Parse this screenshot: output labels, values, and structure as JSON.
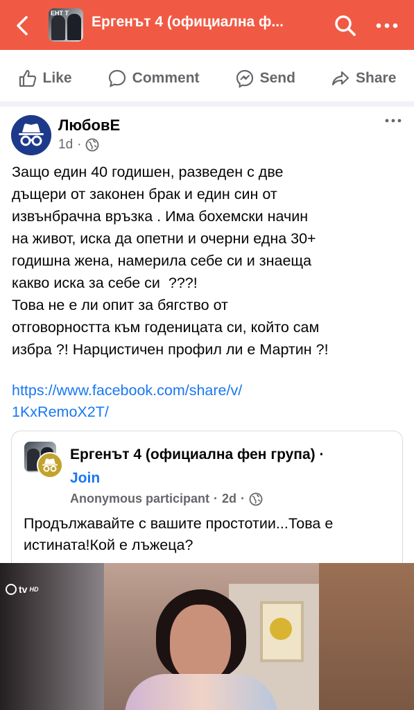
{
  "header": {
    "title": "Ергенът 4 (официална ф...",
    "thumb_text": "ЕНТ Т",
    "bg_color": "#f05a44"
  },
  "actions": [
    {
      "label": "Like",
      "icon": "thumbs-up-icon"
    },
    {
      "label": "Comment",
      "icon": "comment-icon"
    },
    {
      "label": "Send",
      "icon": "messenger-icon"
    },
    {
      "label": "Share",
      "icon": "share-icon"
    }
  ],
  "post": {
    "author": "ЛюбовЕ",
    "time": "1d",
    "separator": "·",
    "body": "Защо един 40 годишен, разведен с две\nдъщери от законен брак и един син от\nизвънбрачна връзка . Има бохемски начин\nна живот, иска да опетни и очерни една 30+\nгодишна жена, намерила себе си и знаеща\nкакво иска за себе си  ???!\nТова не е ли опит за бягство от\nотговорността към годеницата си, който сам\nизбра ?! Нарцистичен профил ли е Мартин ?!",
    "link": "https://www.facebook.com/share/v/\n1KxRemoX2T/"
  },
  "shared": {
    "group_name": "Ергенът 4 (официална фен група) ·",
    "join_label": "Join",
    "participant": "Anonymous participant",
    "time": "2d",
    "separator": "·",
    "body": "Продължавайте с вашите простотии...Това е истината!Кой е лъжеца?"
  },
  "video": {
    "channel_logo": "tv",
    "channel_hd": "HD"
  },
  "colors": {
    "accent": "#1877f2",
    "muted": "#65676b"
  }
}
